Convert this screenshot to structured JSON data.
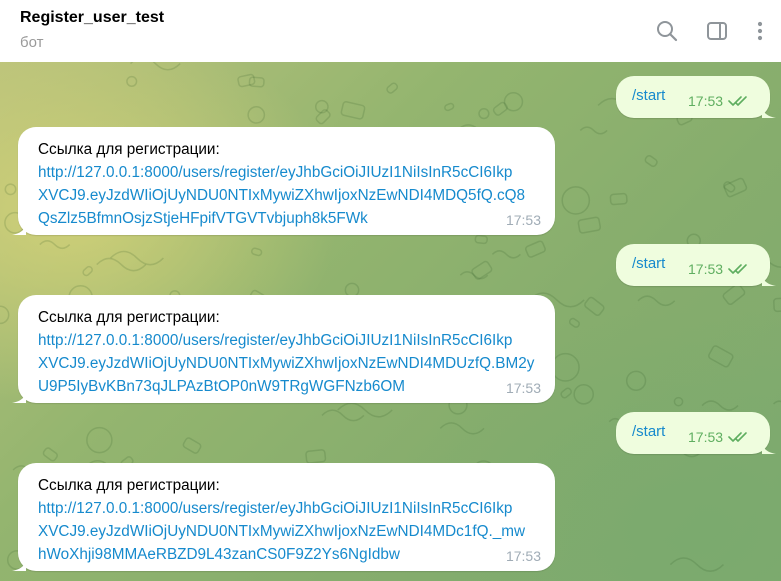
{
  "header": {
    "title": "Register_user_test",
    "subtitle": "бот",
    "icons": [
      "search-icon",
      "sidebar-toggle-icon",
      "more-vertical-icon"
    ]
  },
  "messages": [
    {
      "direction": "out",
      "text": "/start",
      "time": "17:53",
      "status": "read"
    },
    {
      "direction": "in",
      "label": "Ссылка для регистрации:",
      "link_lines": [
        "http://127.0.0.1:8000/users/register/eyJhbGciOiJIUzI1NiIsInR5cCI6Ikp",
        "XVCJ9.eyJzdWIiOjUyNDU0NTIxMywiZXhwIjoxNzEwNDI4MDQ5fQ.cQ8",
        "QsZlz5BfmnOsjzStjeHFpifVTGVTvbjuph8k5FWk"
      ],
      "time": "17:53"
    },
    {
      "direction": "out",
      "text": "/start",
      "time": "17:53",
      "status": "read"
    },
    {
      "direction": "in",
      "label": "Ссылка для регистрации:",
      "link_lines": [
        "http://127.0.0.1:8000/users/register/eyJhbGciOiJIUzI1NiIsInR5cCI6Ikp",
        "XVCJ9.eyJzdWIiOjUyNDU0NTIxMywiZXhwIjoxNzEwNDI4MDUzfQ.BM2y",
        "U9P5IyBvKBn73qJLPAzBtOP0nW9TRgWGFNzb6OM"
      ],
      "time": "17:53"
    },
    {
      "direction": "out",
      "text": "/start",
      "time": "17:53",
      "status": "read"
    },
    {
      "direction": "in",
      "label": "Ссылка для регистрации:",
      "link_lines": [
        "http://127.0.0.1:8000/users/register/eyJhbGciOiJIUzI1NiIsInR5cCI6Ikp",
        "XVCJ9.eyJzdWIiOjUyNDU0NTIxMywiZXhwIjoxNzEwNDI4MDc1fQ._mw",
        "hWoXhji98MMAeRBZD9L43zanCS0F9Z2Ys6NgIdbw"
      ],
      "time": "17:53"
    }
  ],
  "colors": {
    "link": "#168acd",
    "outgoing_bubble": "#effdde",
    "outgoing_time": "#5fae60",
    "incoming_time": "#a0acb6",
    "header_bg": "#ffffff"
  }
}
